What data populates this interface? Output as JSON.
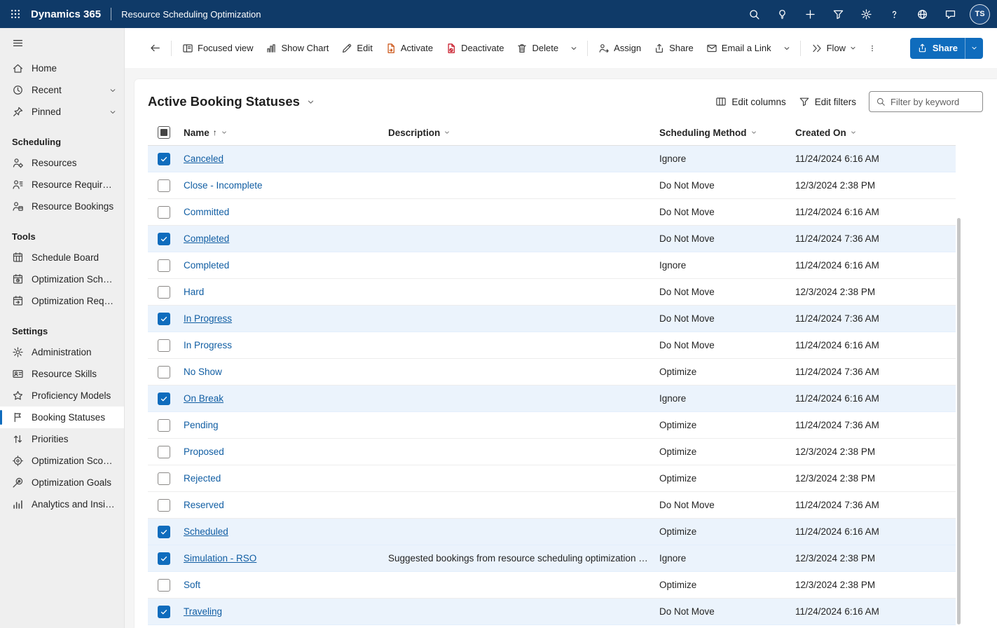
{
  "topbar": {
    "brand": "Dynamics 365",
    "app_name": "Resource Scheduling Optimization",
    "avatar_initials": "TS",
    "icon_buttons": [
      "search",
      "lightbulb",
      "add",
      "filter",
      "settings-gear",
      "help",
      "globe",
      "feedback"
    ]
  },
  "sidebar": {
    "top_items": [
      {
        "label": "Home",
        "icon": "home"
      },
      {
        "label": "Recent",
        "icon": "clock",
        "expandable": true
      },
      {
        "label": "Pinned",
        "icon": "pin",
        "expandable": true
      }
    ],
    "groups": [
      {
        "title": "Scheduling",
        "items": [
          {
            "label": "Resources",
            "icon": "person-wrench"
          },
          {
            "label": "Resource Requireme...",
            "icon": "person-list"
          },
          {
            "label": "Resource Bookings",
            "icon": "person-calendar"
          }
        ]
      },
      {
        "title": "Tools",
        "items": [
          {
            "label": "Schedule Board",
            "icon": "calendar-grid"
          },
          {
            "label": "Optimization Schedu...",
            "icon": "calendar-clock"
          },
          {
            "label": "Optimization Requests",
            "icon": "calendar-arrow"
          }
        ]
      },
      {
        "title": "Settings",
        "items": [
          {
            "label": "Administration",
            "icon": "gear"
          },
          {
            "label": "Resource Skills",
            "icon": "id-card"
          },
          {
            "label": "Proficiency Models",
            "icon": "star"
          },
          {
            "label": "Booking Statuses",
            "icon": "flag",
            "selected": true
          },
          {
            "label": "Priorities",
            "icon": "arrows-sort"
          },
          {
            "label": "Optimization Scopes",
            "icon": "target"
          },
          {
            "label": "Optimization Goals",
            "icon": "goal"
          },
          {
            "label": "Analytics and Insights",
            "icon": "analytics"
          }
        ]
      }
    ]
  },
  "command_bar": {
    "items": [
      {
        "type": "button",
        "label": "Focused view",
        "icon": "focused-view"
      },
      {
        "type": "button",
        "label": "Show Chart",
        "icon": "chart"
      },
      {
        "type": "button",
        "label": "Edit",
        "icon": "pencil"
      },
      {
        "type": "button",
        "label": "Activate",
        "icon": "activate"
      },
      {
        "type": "button",
        "label": "Deactivate",
        "icon": "deactivate"
      },
      {
        "type": "button",
        "label": "Delete",
        "icon": "trash"
      },
      {
        "type": "overflow-chevron"
      },
      {
        "type": "divider"
      },
      {
        "type": "button",
        "label": "Assign",
        "icon": "assign"
      },
      {
        "type": "button",
        "label": "Share",
        "icon": "share"
      },
      {
        "type": "button",
        "label": "Email a Link",
        "icon": "email"
      },
      {
        "type": "overflow-chevron"
      },
      {
        "type": "divider"
      },
      {
        "type": "button",
        "label": "Flow",
        "icon": "flow",
        "caret": true
      },
      {
        "type": "more-ellipsis"
      }
    ],
    "primary_share_label": "Share"
  },
  "view": {
    "title": "Active Booking Statuses",
    "actions": {
      "edit_columns": "Edit columns",
      "edit_filters": "Edit filters"
    },
    "filter_placeholder": "Filter by keyword"
  },
  "grid": {
    "columns": [
      {
        "label": "Name",
        "sorted": "asc"
      },
      {
        "label": "Description"
      },
      {
        "label": "Scheduling Method"
      },
      {
        "label": "Created On"
      }
    ],
    "rows": [
      {
        "name": "Canceled",
        "description": "",
        "method": "Ignore",
        "created": "11/24/2024 6:16 AM",
        "checked": true
      },
      {
        "name": "Close - Incomplete",
        "description": "",
        "method": "Do Not Move",
        "created": "12/3/2024 2:38 PM",
        "checked": false
      },
      {
        "name": "Committed",
        "description": "",
        "method": "Do Not Move",
        "created": "11/24/2024 6:16 AM",
        "checked": false
      },
      {
        "name": "Completed",
        "description": "",
        "method": "Do Not Move",
        "created": "11/24/2024 7:36 AM",
        "checked": true
      },
      {
        "name": "Completed",
        "description": "",
        "method": "Ignore",
        "created": "11/24/2024 6:16 AM",
        "checked": false
      },
      {
        "name": "Hard",
        "description": "",
        "method": "Do Not Move",
        "created": "12/3/2024 2:38 PM",
        "checked": false
      },
      {
        "name": "In Progress",
        "description": "",
        "method": "Do Not Move",
        "created": "11/24/2024 7:36 AM",
        "checked": true
      },
      {
        "name": "In Progress",
        "description": "",
        "method": "Do Not Move",
        "created": "11/24/2024 6:16 AM",
        "checked": false
      },
      {
        "name": "No Show",
        "description": "",
        "method": "Optimize",
        "created": "11/24/2024 7:36 AM",
        "checked": false
      },
      {
        "name": "On Break",
        "description": "",
        "method": "Ignore",
        "created": "11/24/2024 6:16 AM",
        "checked": true
      },
      {
        "name": "Pending",
        "description": "",
        "method": "Optimize",
        "created": "11/24/2024 7:36 AM",
        "checked": false
      },
      {
        "name": "Proposed",
        "description": "",
        "method": "Optimize",
        "created": "12/3/2024 2:38 PM",
        "checked": false
      },
      {
        "name": "Rejected",
        "description": "",
        "method": "Optimize",
        "created": "12/3/2024 2:38 PM",
        "checked": false
      },
      {
        "name": "Reserved",
        "description": "",
        "method": "Do Not Move",
        "created": "11/24/2024 7:36 AM",
        "checked": false
      },
      {
        "name": "Scheduled",
        "description": "",
        "method": "Optimize",
        "created": "11/24/2024 6:16 AM",
        "checked": true
      },
      {
        "name": "Simulation - RSO",
        "description": "Suggested bookings from resource scheduling optimization en...",
        "method": "Ignore",
        "created": "12/3/2024 2:38 PM",
        "checked": true
      },
      {
        "name": "Soft",
        "description": "",
        "method": "Optimize",
        "created": "12/3/2024 2:38 PM",
        "checked": false
      },
      {
        "name": "Traveling",
        "description": "",
        "method": "Do Not Move",
        "created": "11/24/2024 6:16 AM",
        "checked": true
      }
    ]
  },
  "colors": {
    "topbar": "#0f3a68",
    "accent": "#0f6cbd",
    "selected_row": "#ebf3fc",
    "link": "#115ea3"
  }
}
